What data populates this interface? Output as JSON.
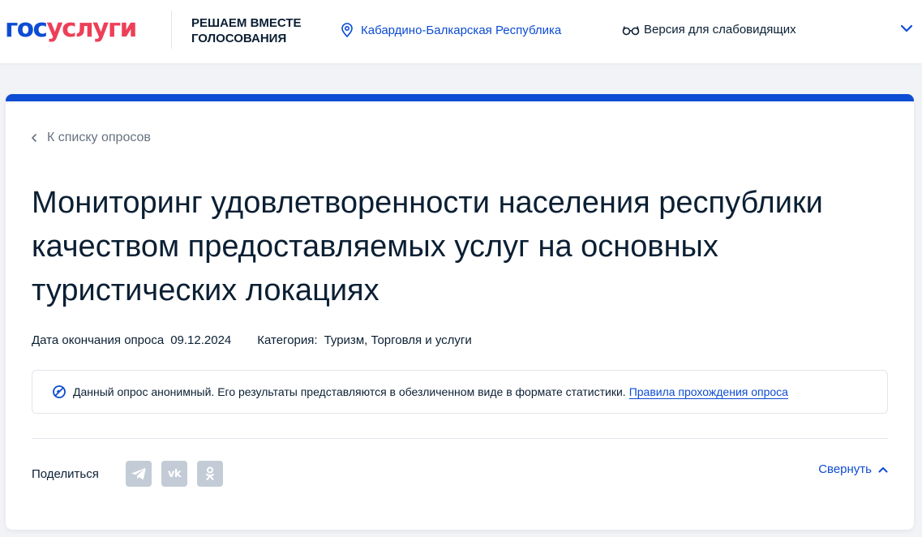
{
  "header": {
    "logo_part1": "гос",
    "logo_part2": "услуги",
    "slogan_line1": "Решаем вместе",
    "slogan_line2": "Голосования",
    "region": "Кабардино-Балкарская Республика",
    "vision_label": "Версия для слабовидящих",
    "icons": [
      "location-pin-icon",
      "glasses-icon",
      "chevron-down-icon"
    ]
  },
  "colors": {
    "brand_blue": "#0d4cd3",
    "brand_red": "#ee3f58",
    "share_gray": "#c3ccd6"
  },
  "survey": {
    "back_label": "К списку опросов",
    "title": "Мониторинг удовлетворенности населения республики качеством предоставляемых услуг на основных туристических локациях",
    "end_date_label": "Дата окончания опроса",
    "end_date": "09.12.2024",
    "category_label": "Категория:",
    "category": "Туризм, Торговля и услуги",
    "notice_text": "Данный опрос анонимный. Его результаты представляются в обезличенном виде в формате статистики.",
    "notice_link": "Правила прохождения опроса"
  },
  "share": {
    "label": "Поделиться",
    "vk_glyph": "vk",
    "icons": [
      "telegram-icon",
      "vk-icon",
      "odnoklassniki-icon"
    ],
    "collapse_label": "Свернуть"
  }
}
